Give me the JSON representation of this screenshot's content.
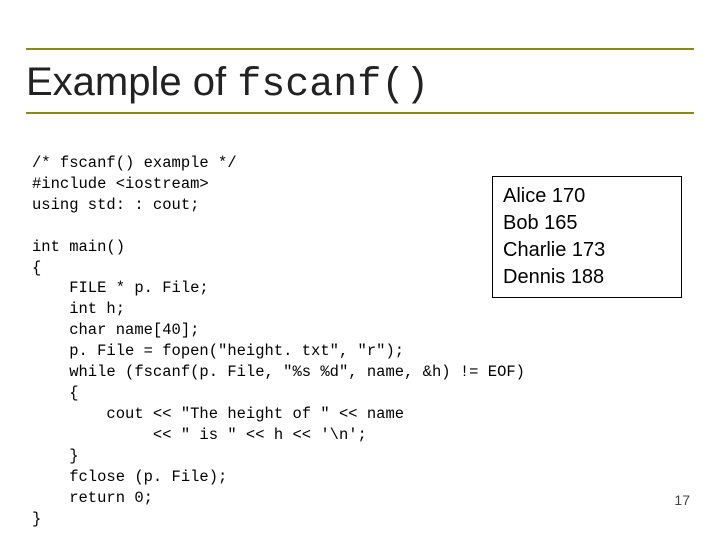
{
  "title": {
    "prefix": "Example of ",
    "mono": "fscanf()"
  },
  "code": {
    "lines": [
      "/* fscanf() example */",
      "#include <iostream>",
      "using std: : cout;",
      "",
      "int main()",
      "{",
      "    FILE * p. File;",
      "    int h;",
      "    char name[40];",
      "    p. File = fopen(\"height. txt\", \"r\");",
      "    while (fscanf(p. File, \"%s %d\", name, &h) != EOF)",
      "    {",
      "        cout << \"The height of \" << name",
      "             << \" is \" << h << '\\n';",
      "    }",
      "    fclose (p. File);",
      "    return 0;",
      "}"
    ]
  },
  "output": {
    "lines": [
      "Alice 170",
      "Bob 165",
      "Charlie 173",
      "Dennis 188"
    ]
  },
  "slide_number": "17"
}
